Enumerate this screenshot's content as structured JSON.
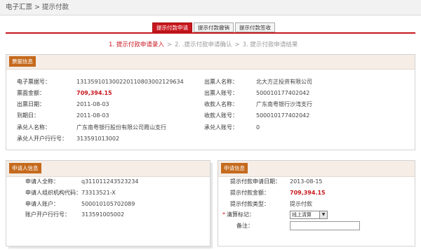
{
  "breadcrumb": "电子汇票 > 提示付款",
  "tabs": [
    {
      "label": "提示付款申请",
      "active": true
    },
    {
      "label": "提示付款撤销",
      "active": false
    },
    {
      "label": "提示付款签收",
      "active": false
    }
  ],
  "steps": {
    "step1": "1. 提示付款申请录入",
    "step2": "2. .提示付款申请确认",
    "step3": "3. 提示付款申请结果",
    "sep": ">"
  },
  "bill_info": {
    "title": "票据信息",
    "left": [
      {
        "label": "电子票据号：",
        "value": "131359101300220110803002129634"
      },
      {
        "label": "票面金额：",
        "value": "709,394.15"
      },
      {
        "label": "出票日期：",
        "value": "2011-08-03"
      },
      {
        "label": "到期日：",
        "value": "2011-08-03"
      },
      {
        "label": "承兑人名称：",
        "value": "广东南粤银行股份有限公司霞山支行"
      },
      {
        "label": "承兑人开户行行号：",
        "value": "313591013002"
      }
    ],
    "right": [
      {
        "label": "出票人名称：",
        "value": "北大方正投资有限公司"
      },
      {
        "label": "出票人账号：",
        "value": "500010177402042"
      },
      {
        "label": "收款人名称：",
        "value": "广东南粤银行沙湾支行"
      },
      {
        "label": "收款人账号：",
        "value": "500010177402042"
      },
      {
        "label": "承兑人账号：",
        "value": "0"
      }
    ]
  },
  "applicant_info": {
    "title": "申请人信息",
    "rows": [
      {
        "label": "申请人全称：",
        "value": "q311011243523234"
      },
      {
        "label": "申请人组织机构代码：",
        "value": "73313521-X"
      },
      {
        "label": "申请人账户：",
        "value": "500010105702089"
      },
      {
        "label": "账户开户行行号：",
        "value": "313591005002"
      }
    ]
  },
  "application_info": {
    "title": "申请信息",
    "date": {
      "label": "提示付款申请日期：",
      "value": "2013-08-15"
    },
    "amount": {
      "label": "提示付款金额：",
      "value": "709,394.15"
    },
    "type": {
      "label": "提示付款类型：",
      "value": "提示付款"
    },
    "clearing": {
      "required_mark": "*",
      "label": "清算标记：",
      "value": "线上清算",
      "arrow": "▼"
    },
    "remark": {
      "label": "备注：",
      "value": ""
    }
  },
  "colors": {
    "accent": "#c8171e",
    "ribbon": "#c56a1d"
  }
}
